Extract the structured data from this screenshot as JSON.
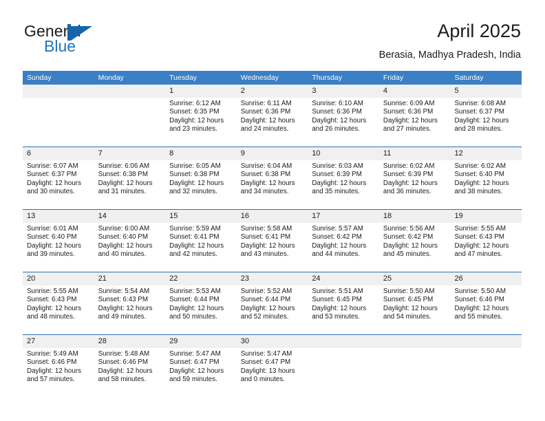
{
  "brand": {
    "name_part1": "General",
    "name_part2": "Blue",
    "logo_icon": "sailboat-logo-icon",
    "accent_color": "#1e74bb"
  },
  "header": {
    "title": "April 2025",
    "subtitle": "Berasia, Madhya Pradesh, India"
  },
  "theme": {
    "header_blue": "#3b7fc4",
    "week_divider_blue": "#2f6fb0",
    "date_band_gray": "#f0f0f0",
    "text_color": "#1a1a1a"
  },
  "calendar": {
    "weekdays": [
      "Sunday",
      "Monday",
      "Tuesday",
      "Wednesday",
      "Thursday",
      "Friday",
      "Saturday"
    ],
    "weeks": [
      [
        {
          "day": ""
        },
        {
          "day": ""
        },
        {
          "day": "1",
          "sunrise": "Sunrise: 6:12 AM",
          "sunset": "Sunset: 6:35 PM",
          "daylight_line1": "Daylight: 12 hours",
          "daylight_line2": "and 23 minutes."
        },
        {
          "day": "2",
          "sunrise": "Sunrise: 6:11 AM",
          "sunset": "Sunset: 6:36 PM",
          "daylight_line1": "Daylight: 12 hours",
          "daylight_line2": "and 24 minutes."
        },
        {
          "day": "3",
          "sunrise": "Sunrise: 6:10 AM",
          "sunset": "Sunset: 6:36 PM",
          "daylight_line1": "Daylight: 12 hours",
          "daylight_line2": "and 26 minutes."
        },
        {
          "day": "4",
          "sunrise": "Sunrise: 6:09 AM",
          "sunset": "Sunset: 6:36 PM",
          "daylight_line1": "Daylight: 12 hours",
          "daylight_line2": "and 27 minutes."
        },
        {
          "day": "5",
          "sunrise": "Sunrise: 6:08 AM",
          "sunset": "Sunset: 6:37 PM",
          "daylight_line1": "Daylight: 12 hours",
          "daylight_line2": "and 28 minutes."
        }
      ],
      [
        {
          "day": "6",
          "sunrise": "Sunrise: 6:07 AM",
          "sunset": "Sunset: 6:37 PM",
          "daylight_line1": "Daylight: 12 hours",
          "daylight_line2": "and 30 minutes."
        },
        {
          "day": "7",
          "sunrise": "Sunrise: 6:06 AM",
          "sunset": "Sunset: 6:38 PM",
          "daylight_line1": "Daylight: 12 hours",
          "daylight_line2": "and 31 minutes."
        },
        {
          "day": "8",
          "sunrise": "Sunrise: 6:05 AM",
          "sunset": "Sunset: 6:38 PM",
          "daylight_line1": "Daylight: 12 hours",
          "daylight_line2": "and 32 minutes."
        },
        {
          "day": "9",
          "sunrise": "Sunrise: 6:04 AM",
          "sunset": "Sunset: 6:38 PM",
          "daylight_line1": "Daylight: 12 hours",
          "daylight_line2": "and 34 minutes."
        },
        {
          "day": "10",
          "sunrise": "Sunrise: 6:03 AM",
          "sunset": "Sunset: 6:39 PM",
          "daylight_line1": "Daylight: 12 hours",
          "daylight_line2": "and 35 minutes."
        },
        {
          "day": "11",
          "sunrise": "Sunrise: 6:02 AM",
          "sunset": "Sunset: 6:39 PM",
          "daylight_line1": "Daylight: 12 hours",
          "daylight_line2": "and 36 minutes."
        },
        {
          "day": "12",
          "sunrise": "Sunrise: 6:02 AM",
          "sunset": "Sunset: 6:40 PM",
          "daylight_line1": "Daylight: 12 hours",
          "daylight_line2": "and 38 minutes."
        }
      ],
      [
        {
          "day": "13",
          "sunrise": "Sunrise: 6:01 AM",
          "sunset": "Sunset: 6:40 PM",
          "daylight_line1": "Daylight: 12 hours",
          "daylight_line2": "and 39 minutes."
        },
        {
          "day": "14",
          "sunrise": "Sunrise: 6:00 AM",
          "sunset": "Sunset: 6:40 PM",
          "daylight_line1": "Daylight: 12 hours",
          "daylight_line2": "and 40 minutes."
        },
        {
          "day": "15",
          "sunrise": "Sunrise: 5:59 AM",
          "sunset": "Sunset: 6:41 PM",
          "daylight_line1": "Daylight: 12 hours",
          "daylight_line2": "and 42 minutes."
        },
        {
          "day": "16",
          "sunrise": "Sunrise: 5:58 AM",
          "sunset": "Sunset: 6:41 PM",
          "daylight_line1": "Daylight: 12 hours",
          "daylight_line2": "and 43 minutes."
        },
        {
          "day": "17",
          "sunrise": "Sunrise: 5:57 AM",
          "sunset": "Sunset: 6:42 PM",
          "daylight_line1": "Daylight: 12 hours",
          "daylight_line2": "and 44 minutes."
        },
        {
          "day": "18",
          "sunrise": "Sunrise: 5:56 AM",
          "sunset": "Sunset: 6:42 PM",
          "daylight_line1": "Daylight: 12 hours",
          "daylight_line2": "and 45 minutes."
        },
        {
          "day": "19",
          "sunrise": "Sunrise: 5:55 AM",
          "sunset": "Sunset: 6:43 PM",
          "daylight_line1": "Daylight: 12 hours",
          "daylight_line2": "and 47 minutes."
        }
      ],
      [
        {
          "day": "20",
          "sunrise": "Sunrise: 5:55 AM",
          "sunset": "Sunset: 6:43 PM",
          "daylight_line1": "Daylight: 12 hours",
          "daylight_line2": "and 48 minutes."
        },
        {
          "day": "21",
          "sunrise": "Sunrise: 5:54 AM",
          "sunset": "Sunset: 6:43 PM",
          "daylight_line1": "Daylight: 12 hours",
          "daylight_line2": "and 49 minutes."
        },
        {
          "day": "22",
          "sunrise": "Sunrise: 5:53 AM",
          "sunset": "Sunset: 6:44 PM",
          "daylight_line1": "Daylight: 12 hours",
          "daylight_line2": "and 50 minutes."
        },
        {
          "day": "23",
          "sunrise": "Sunrise: 5:52 AM",
          "sunset": "Sunset: 6:44 PM",
          "daylight_line1": "Daylight: 12 hours",
          "daylight_line2": "and 52 minutes."
        },
        {
          "day": "24",
          "sunrise": "Sunrise: 5:51 AM",
          "sunset": "Sunset: 6:45 PM",
          "daylight_line1": "Daylight: 12 hours",
          "daylight_line2": "and 53 minutes."
        },
        {
          "day": "25",
          "sunrise": "Sunrise: 5:50 AM",
          "sunset": "Sunset: 6:45 PM",
          "daylight_line1": "Daylight: 12 hours",
          "daylight_line2": "and 54 minutes."
        },
        {
          "day": "26",
          "sunrise": "Sunrise: 5:50 AM",
          "sunset": "Sunset: 6:46 PM",
          "daylight_line1": "Daylight: 12 hours",
          "daylight_line2": "and 55 minutes."
        }
      ],
      [
        {
          "day": "27",
          "sunrise": "Sunrise: 5:49 AM",
          "sunset": "Sunset: 6:46 PM",
          "daylight_line1": "Daylight: 12 hours",
          "daylight_line2": "and 57 minutes."
        },
        {
          "day": "28",
          "sunrise": "Sunrise: 5:48 AM",
          "sunset": "Sunset: 6:46 PM",
          "daylight_line1": "Daylight: 12 hours",
          "daylight_line2": "and 58 minutes."
        },
        {
          "day": "29",
          "sunrise": "Sunrise: 5:47 AM",
          "sunset": "Sunset: 6:47 PM",
          "daylight_line1": "Daylight: 12 hours",
          "daylight_line2": "and 59 minutes."
        },
        {
          "day": "30",
          "sunrise": "Sunrise: 5:47 AM",
          "sunset": "Sunset: 6:47 PM",
          "daylight_line1": "Daylight: 13 hours",
          "daylight_line2": "and 0 minutes."
        },
        {
          "day": ""
        },
        {
          "day": ""
        },
        {
          "day": ""
        }
      ]
    ]
  }
}
